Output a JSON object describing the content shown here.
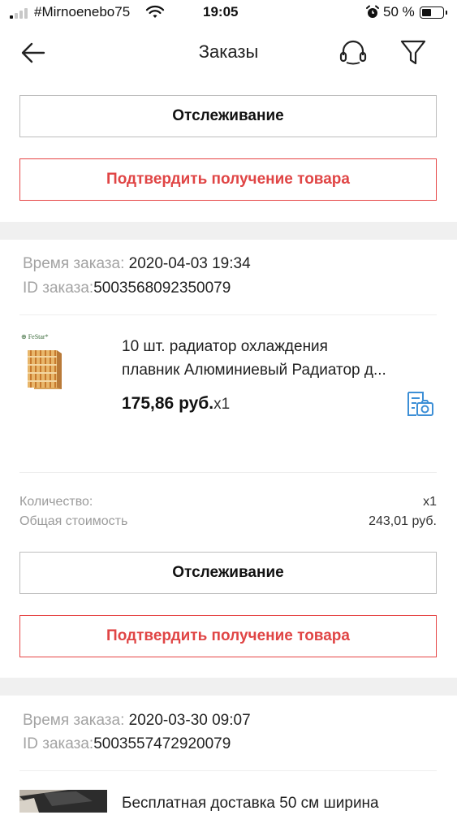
{
  "status_bar": {
    "carrier": "#Mirnoenebo75",
    "time": "19:05",
    "battery": "50 %",
    "battery_level": 0.5
  },
  "header": {
    "title": "Заказы",
    "icons": [
      "back-arrow-icon",
      "headset-icon",
      "filter-icon"
    ]
  },
  "orders": [
    {
      "buttons": {
        "track": "Отслеживание",
        "confirm": "Подтвердить получение товара"
      }
    },
    {
      "order_time_label": "Время заказа:",
      "order_time": "2020-04-03 19:34",
      "order_id_label": "ID заказа:",
      "order_id": "5003568092350079",
      "product": {
        "thumb_brand": "FeStar",
        "name_line1": "10 шт. радиатор охлаждения",
        "name_line2": "плавник Алюминиевый Радиатор д...",
        "price": "175,86 руб.",
        "qty": "x1"
      },
      "summary": {
        "quantity_label": "Количество:",
        "quantity_value": "x1",
        "total_label": "Общая стоимость",
        "total_value": "243,01 руб."
      },
      "buttons": {
        "track": "Отслеживание",
        "confirm": "Подтвердить получение товара"
      }
    },
    {
      "order_time_label": "Время заказа:",
      "order_time": "2020-03-30 09:07",
      "order_id_label": "ID заказа:",
      "order_id": "5003557472920079",
      "product": {
        "name_line1": "Бесплатная доставка 50 см ширина"
      }
    }
  ],
  "colors": {
    "accent_red": "#e64545",
    "separator": "#f0f0f0",
    "muted_text": "#a3a3a3",
    "icon_blue": "#3d8fd6"
  }
}
